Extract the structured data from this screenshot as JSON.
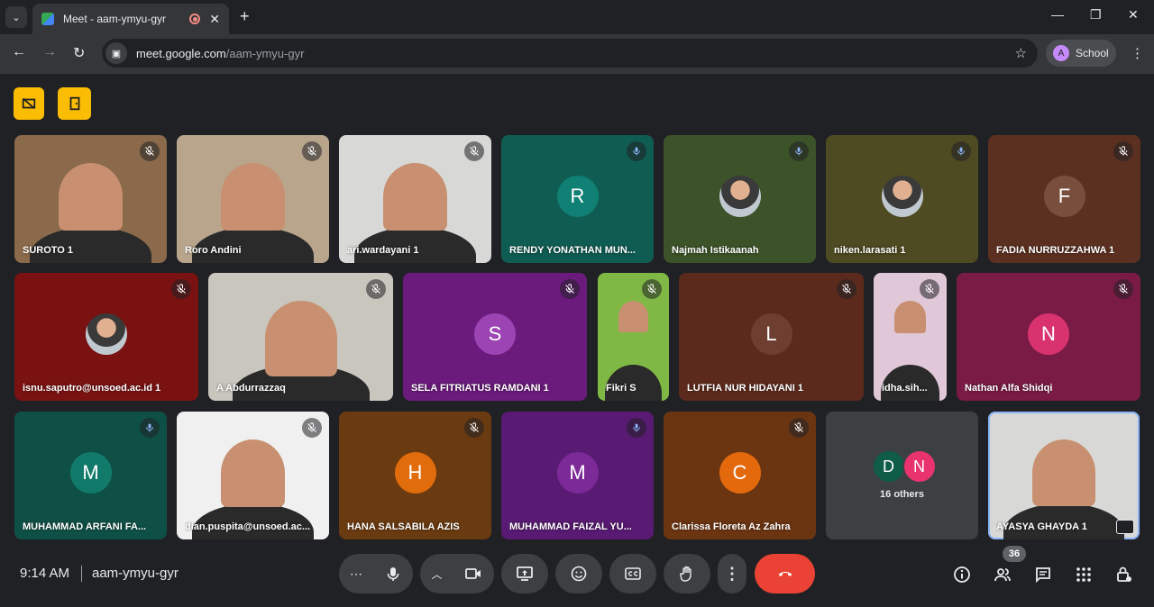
{
  "browser": {
    "tab_title": "Meet - aam-ymyu-gyr",
    "tab_close": "✕",
    "new_tab": "+",
    "url_host": "meet.google.com",
    "url_path": "/aam-ymyu-gyr",
    "profile_initial": "A",
    "profile_label": "School"
  },
  "tiles": [
    {
      "name": "SUROTO 1",
      "kind": "video",
      "bg": "#8a6a4a"
    },
    {
      "name": "Roro Andini",
      "kind": "video",
      "bg": "#b8a58c"
    },
    {
      "name": "ari.wardayani 1",
      "kind": "video",
      "bg": "#d8d8d6"
    },
    {
      "name": "RENDY YONATHAN MUN...",
      "kind": "letter",
      "letter": "R",
      "bg": "#0f5c52",
      "circle": "#0f8073",
      "mic": "active"
    },
    {
      "name": "Najmah Istikaanah",
      "kind": "photo",
      "bg": "#3c5228",
      "mic": "active"
    },
    {
      "name": "niken.larasati 1",
      "kind": "photo",
      "bg": "#4e4a22",
      "mic": "active"
    },
    {
      "name": "FADIA NURRUZZAHWA 1",
      "kind": "letter",
      "letter": "F",
      "bg": "#5c3020",
      "circle": "#7a4e3c"
    },
    {
      "name": "isnu.saputro@unsoed.ac.id 1",
      "kind": "photo",
      "bg": "#7a1212"
    },
    {
      "name": "A Abdurrazzaq",
      "kind": "video",
      "bg": "#c9c6be"
    },
    {
      "name": "SELA FITRIATUS RAMDANI 1",
      "kind": "letter",
      "letter": "S",
      "bg": "#6a1b7c",
      "circle": "#9c44b4"
    },
    {
      "name": "Fikri S",
      "kind": "video",
      "bg": "#7fb844"
    },
    {
      "name": "LUTFIA NUR HIDAYANI 1",
      "kind": "letter",
      "letter": "L",
      "bg": "#5c2a1c",
      "circle": "#6e3e30"
    },
    {
      "name": "idha.sih...",
      "kind": "video",
      "bg": "#e0c8d8"
    },
    {
      "name": "Nathan Alfa Shidqi",
      "kind": "letter",
      "letter": "N",
      "bg": "#7a1b45",
      "circle": "#d8336e"
    },
    {
      "name": "MUHAMMAD ARFANI FA...",
      "kind": "letter",
      "letter": "M",
      "bg": "#0f5046",
      "circle": "#127a6a",
      "mic": "active"
    },
    {
      "name": "dian.puspita@unsoed.ac...",
      "kind": "video",
      "bg": "#f0f0f0"
    },
    {
      "name": "HANA SALSABILA AZIS",
      "kind": "letter",
      "letter": "H",
      "bg": "#6a3a10",
      "circle": "#e06c0c"
    },
    {
      "name": "MUHAMMAD FAIZAL YU...",
      "kind": "letter",
      "letter": "M",
      "bg": "#581a72",
      "circle": "#7b2a98",
      "mic": "active"
    },
    {
      "name": "Clarissa Floreta Az Zahra",
      "kind": "letter",
      "letter": "C",
      "bg": "#6c3512",
      "circle": "#e4690d"
    },
    {
      "name": "",
      "kind": "others",
      "bg": "#3c4043"
    },
    {
      "name": "AYASYA GHAYDA 1",
      "kind": "video",
      "bg": "#d8d8d6",
      "self": true
    }
  ],
  "others": {
    "initials": [
      "D",
      "N"
    ],
    "label": "16 others",
    "colors": [
      "#0f5c48",
      "#e8336e"
    ]
  },
  "footer": {
    "time": "9:14 AM",
    "meeting_code": "aam-ymyu-gyr",
    "people_count": "36"
  },
  "colors": {
    "end_call": "#ea4335",
    "highlight": "#fbbc04"
  }
}
